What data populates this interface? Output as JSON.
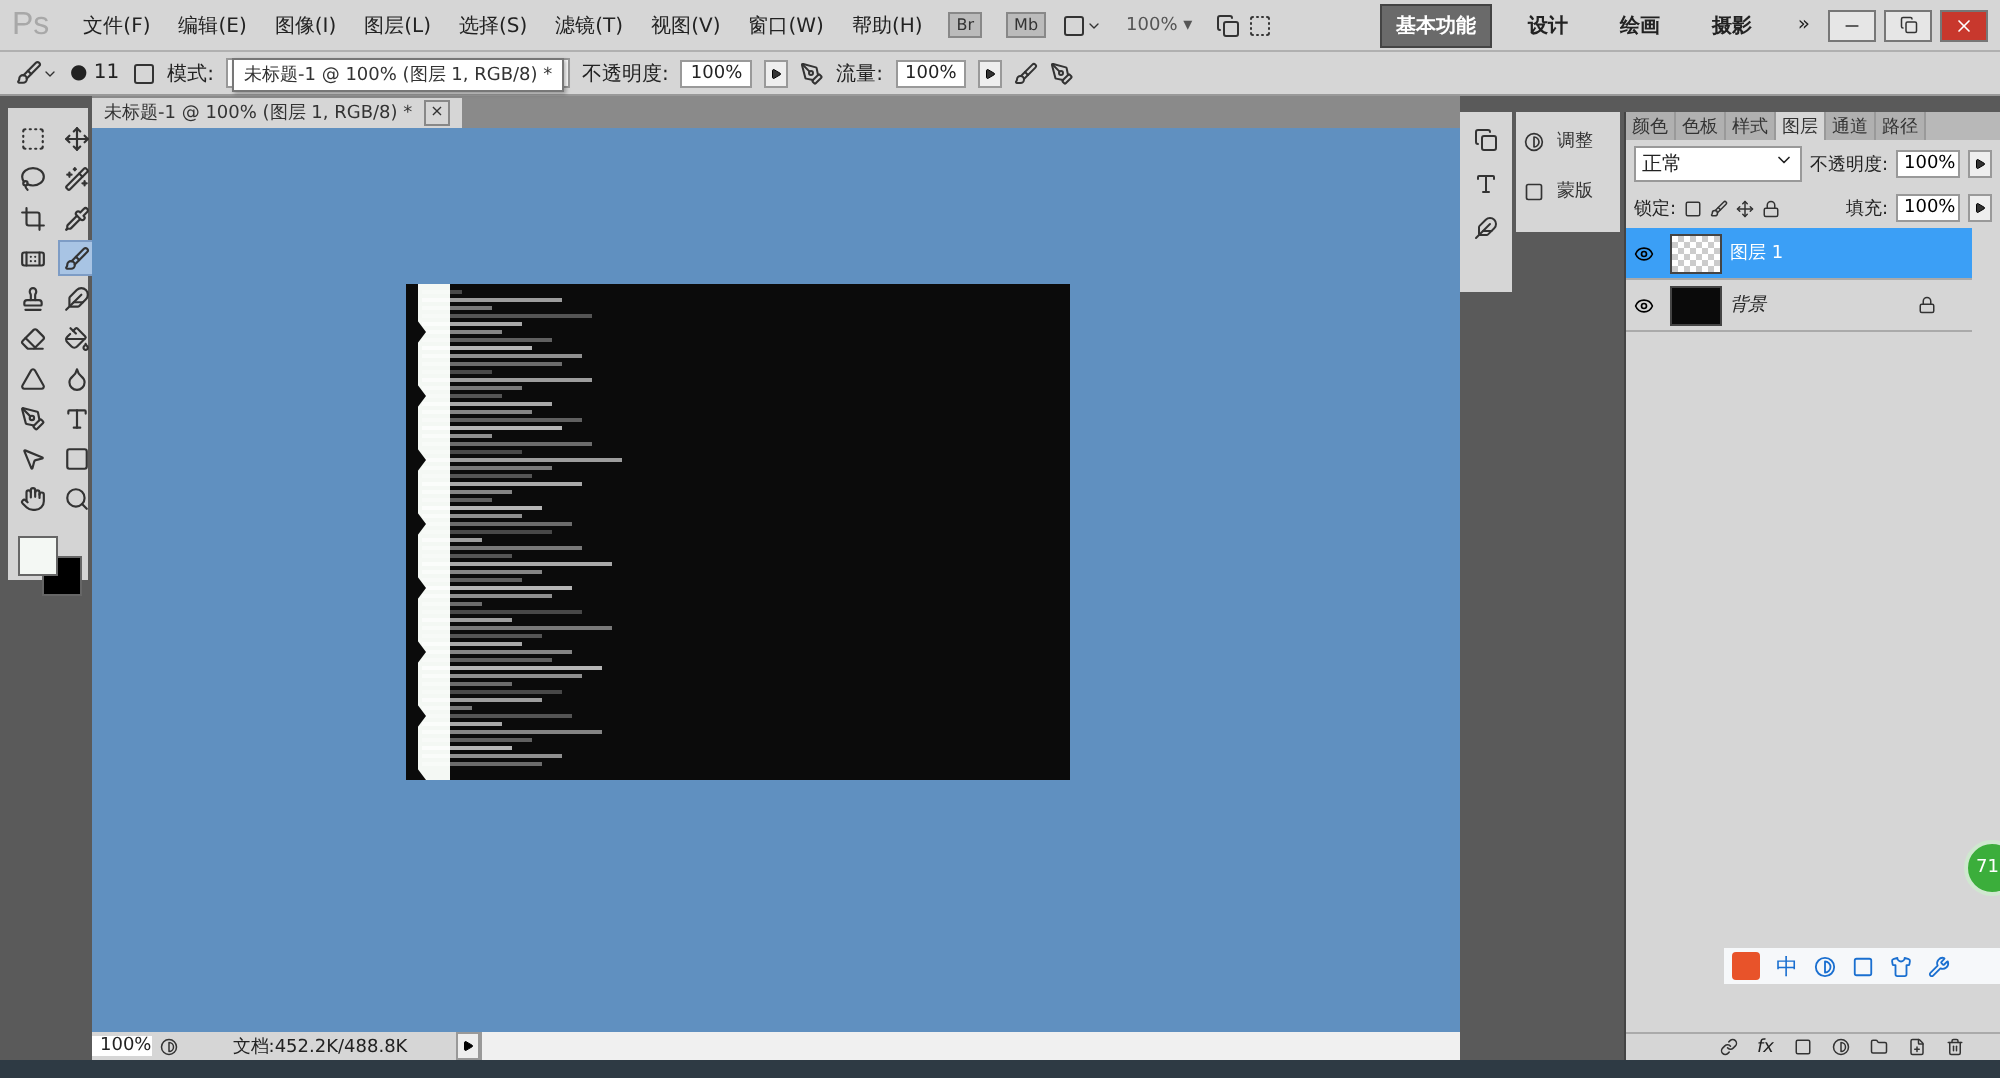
{
  "app_logo": "Ps",
  "menu": [
    "文件(F)",
    "编辑(E)",
    "图像(I)",
    "图层(L)",
    "选择(S)",
    "滤镜(T)",
    "视图(V)",
    "窗口(W)",
    "帮助(H)"
  ],
  "app_bar": {
    "buttons": [
      "Br",
      "Mb"
    ],
    "zoom": "100%",
    "zoom_caret": "▾"
  },
  "workspaces": [
    {
      "label": "基本功能",
      "selected": true
    },
    {
      "label": "设计",
      "selected": false
    },
    {
      "label": "绘画",
      "selected": false
    },
    {
      "label": "摄影",
      "selected": false
    }
  ],
  "more_workspaces": "»",
  "options_bar": {
    "brush_dot": "●",
    "brush_size": "11",
    "mode_label": "模式:",
    "opacity_label": "不透明度:",
    "opacity": "100%",
    "flow_label": "流量:",
    "flow": "100%"
  },
  "tooltip": "未标题-1 @ 100% (图层 1, RGB/8) *",
  "document": {
    "tab": "未标题-1 @ 100% (图层 1, RGB/8) *",
    "close": "×",
    "zoom": "100%",
    "doc_info": "文档:452.2K/488.8K"
  },
  "tools": [
    {
      "selected": false
    },
    {
      "selected": false
    },
    {
      "selected": false
    },
    {
      "selected": false
    },
    {
      "selected": false
    },
    {
      "selected": false
    },
    {
      "selected": false
    },
    {
      "selected": true
    },
    {
      "selected": false
    },
    {
      "selected": false
    },
    {
      "selected": false
    },
    {
      "selected": false
    },
    {
      "selected": false
    },
    {
      "selected": false
    },
    {
      "selected": false
    },
    {
      "selected": false
    },
    {
      "selected": false
    },
    {
      "selected": false
    },
    {
      "selected": false
    },
    {
      "selected": false
    }
  ],
  "mini_panels": [
    "调整",
    "蒙版"
  ],
  "layers_panel": {
    "tabs": [
      {
        "label": "颜色",
        "selected": false
      },
      {
        "label": "色板",
        "selected": false
      },
      {
        "label": "样式",
        "selected": false
      },
      {
        "label": "图层",
        "selected": true
      },
      {
        "label": "通道",
        "selected": false
      },
      {
        "label": "路径",
        "selected": false
      }
    ],
    "footer_fx": "fx",
    "blend_mode": "正常",
    "opacity_label": "不透明度:",
    "opacity": "100%",
    "lock_label": "锁定:",
    "fill_label": "填充:",
    "fill": "100%",
    "layers": [
      {
        "name": "图层 1",
        "selected": true,
        "locked": false,
        "kind": "transparent"
      },
      {
        "name": "背景",
        "selected": false,
        "locked": true,
        "kind": "black"
      }
    ]
  },
  "ime_bar": {
    "mode": "中"
  },
  "floating_badge": "71"
}
